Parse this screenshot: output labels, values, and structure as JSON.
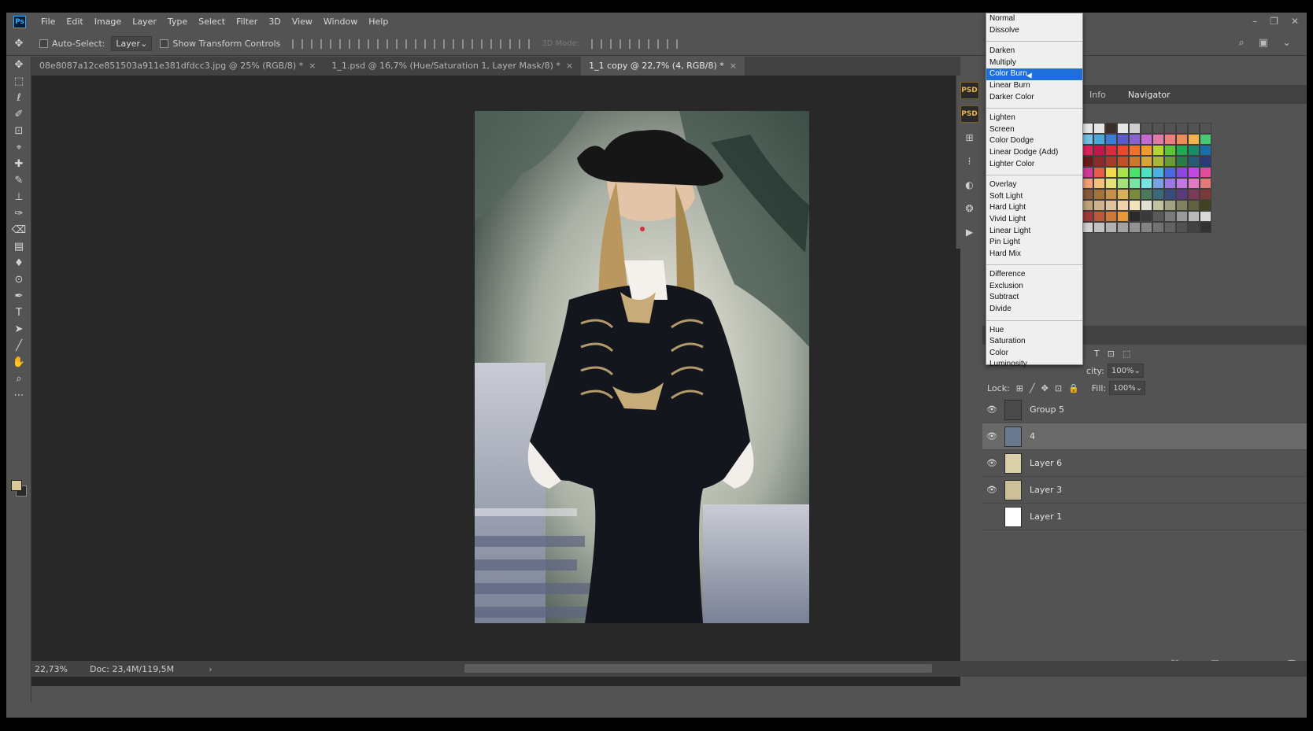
{
  "menubar": {
    "logo": "Ps",
    "items": [
      "File",
      "Edit",
      "Image",
      "Layer",
      "Type",
      "Select",
      "Filter",
      "3D",
      "View",
      "Window",
      "Help"
    ],
    "controls": [
      "–",
      "❐",
      "✕"
    ]
  },
  "options": {
    "auto_select_label": "Auto-Select:",
    "auto_select_value": "Layer",
    "show_transform_label": "Show Transform Controls",
    "mode_3d_label": "3D Mode:",
    "right_icons": [
      "⌕",
      "▣",
      "⌄"
    ]
  },
  "tabs": [
    {
      "label": "08e8087a12ce851503a911e381dfdcc3.jpg @ 25% (RGB/8) *",
      "close": "×"
    },
    {
      "label": "1_1.psd @ 16,7% (Hue/Saturation 1, Layer Mask/8) *",
      "close": "×"
    },
    {
      "label": "1_1 copy @ 22,7% (4, RGB/8) *",
      "close": "×"
    }
  ],
  "tools": [
    "✥",
    "⬚",
    "ℓ",
    "✐",
    "⊡",
    "⌖",
    "✚",
    "✎",
    "⊥",
    "✑",
    "⌫",
    "▤",
    "♦",
    "⊙",
    "✒",
    "T",
    "➤",
    "╱",
    "✋",
    "⌕",
    "⋯"
  ],
  "status": {
    "zoom": "22,73%",
    "doc": "Doc: 23,4M/119,5M",
    "arrow": "›"
  },
  "strip": {
    "psd1": "PSD",
    "psd2": "PSD",
    "glyphs": [
      "⊞",
      "⁞",
      "◐",
      "❂",
      "▶"
    ]
  },
  "right_panel": {
    "tabs": [
      "Info",
      "Navigator"
    ],
    "swatch_colors": [
      "#e6e6e6",
      "#e6e6e6",
      "#3c2e28",
      "#e6e6e6",
      "#cfcfcf",
      "#535353",
      "#535353",
      "#535353",
      "#535353",
      "#535353",
      "#535353",
      "#73c0e6",
      "#4aa9d9",
      "#3b7bd9",
      "#5a5ad1",
      "#8a62d1",
      "#c46ad1",
      "#e27aa8",
      "#ef7d7d",
      "#ef8c5a",
      "#f0b44a",
      "#48c872",
      "#e0205a",
      "#c8144a",
      "#e2283c",
      "#f0462e",
      "#f2702a",
      "#f49a2a",
      "#b6d42e",
      "#5fc63a",
      "#22a852",
      "#1b8a66",
      "#1a6ea8",
      "#6a1a1a",
      "#8a2a2a",
      "#a83a2a",
      "#c0522a",
      "#c87a2a",
      "#d4a63a",
      "#a8b63a",
      "#6a9a3a",
      "#2a7a4a",
      "#2a5a7a",
      "#2a3a7a",
      "#d43a9a",
      "#e85a4a",
      "#f2d84a",
      "#a8e24a",
      "#4ae26a",
      "#4ae2c2",
      "#4ab2e2",
      "#4a6ae2",
      "#8a4ae2",
      "#c24ae2",
      "#e24a9a",
      "#f2a27a",
      "#f2c27a",
      "#e2e27a",
      "#a2e27a",
      "#7ae2a2",
      "#7ae2e2",
      "#7aa2e2",
      "#9a7ae2",
      "#c27ae2",
      "#e27ac2",
      "#e27a7a",
      "#8a5a3a",
      "#a8703a",
      "#c8904a",
      "#d8b05a",
      "#7a8a3a",
      "#4a7a5a",
      "#3a6a7a",
      "#3a4a7a",
      "#5a3a7a",
      "#7a3a5a",
      "#7a3a3a",
      "#c2a27a",
      "#d2b28a",
      "#e2c29a",
      "#f2d2aa",
      "#f2e2ba",
      "#e2e2d2",
      "#c2c2a2",
      "#a2a282",
      "#828262",
      "#626242",
      "#424222",
      "#a03a3a",
      "#b85a3a",
      "#d07a3a",
      "#e89a3a",
      "#2a2a2a",
      "#3a3a3a",
      "#5a5a5a",
      "#7a7a7a",
      "#9a9a9a",
      "#bababa",
      "#dadada",
      "#d2d2d2",
      "#c2c2c2",
      "#b2b2b2",
      "#a2a2a2",
      "#929292",
      "#828282",
      "#727272",
      "#626262",
      "#525252",
      "#424242",
      "#323232"
    ]
  },
  "layers": {
    "opacity_label": "city:",
    "opacity_value": "100%",
    "lock_label": "Lock:",
    "fill_label": "Fill:",
    "fill_value": "100%",
    "rows": [
      {
        "name": "Group 5",
        "eye": "👁",
        "selected": false,
        "thumb": "#4a4a4a"
      },
      {
        "name": "4",
        "eye": "👁",
        "selected": true,
        "thumb": "#6a7890"
      },
      {
        "name": "Layer 6",
        "eye": "👁",
        "selected": false,
        "thumb": "#d9cfa8"
      },
      {
        "name": "Layer 3",
        "eye": "👁",
        "selected": false,
        "thumb": "#cdbf98"
      },
      {
        "name": "Layer 1",
        "eye": "",
        "selected": false,
        "thumb": "#ffffff"
      }
    ],
    "bottom_icons": [
      "⛓",
      "fx",
      "◙",
      "◑",
      "▬",
      "⊞",
      "🗑"
    ]
  },
  "blend_modes": {
    "selected": "Color Burn",
    "groups": [
      [
        "Normal",
        "Dissolve"
      ],
      [
        "Darken",
        "Multiply",
        "Color Burn",
        "Linear Burn",
        "Darker Color"
      ],
      [
        "Lighten",
        "Screen",
        "Color Dodge",
        "Linear Dodge (Add)",
        "Lighter Color"
      ],
      [
        "Overlay",
        "Soft Light",
        "Hard Light",
        "Vivid Light",
        "Linear Light",
        "Pin Light",
        "Hard Mix"
      ],
      [
        "Difference",
        "Exclusion",
        "Subtract",
        "Divide"
      ],
      [
        "Hue",
        "Saturation",
        "Color",
        "Luminosity"
      ]
    ]
  }
}
